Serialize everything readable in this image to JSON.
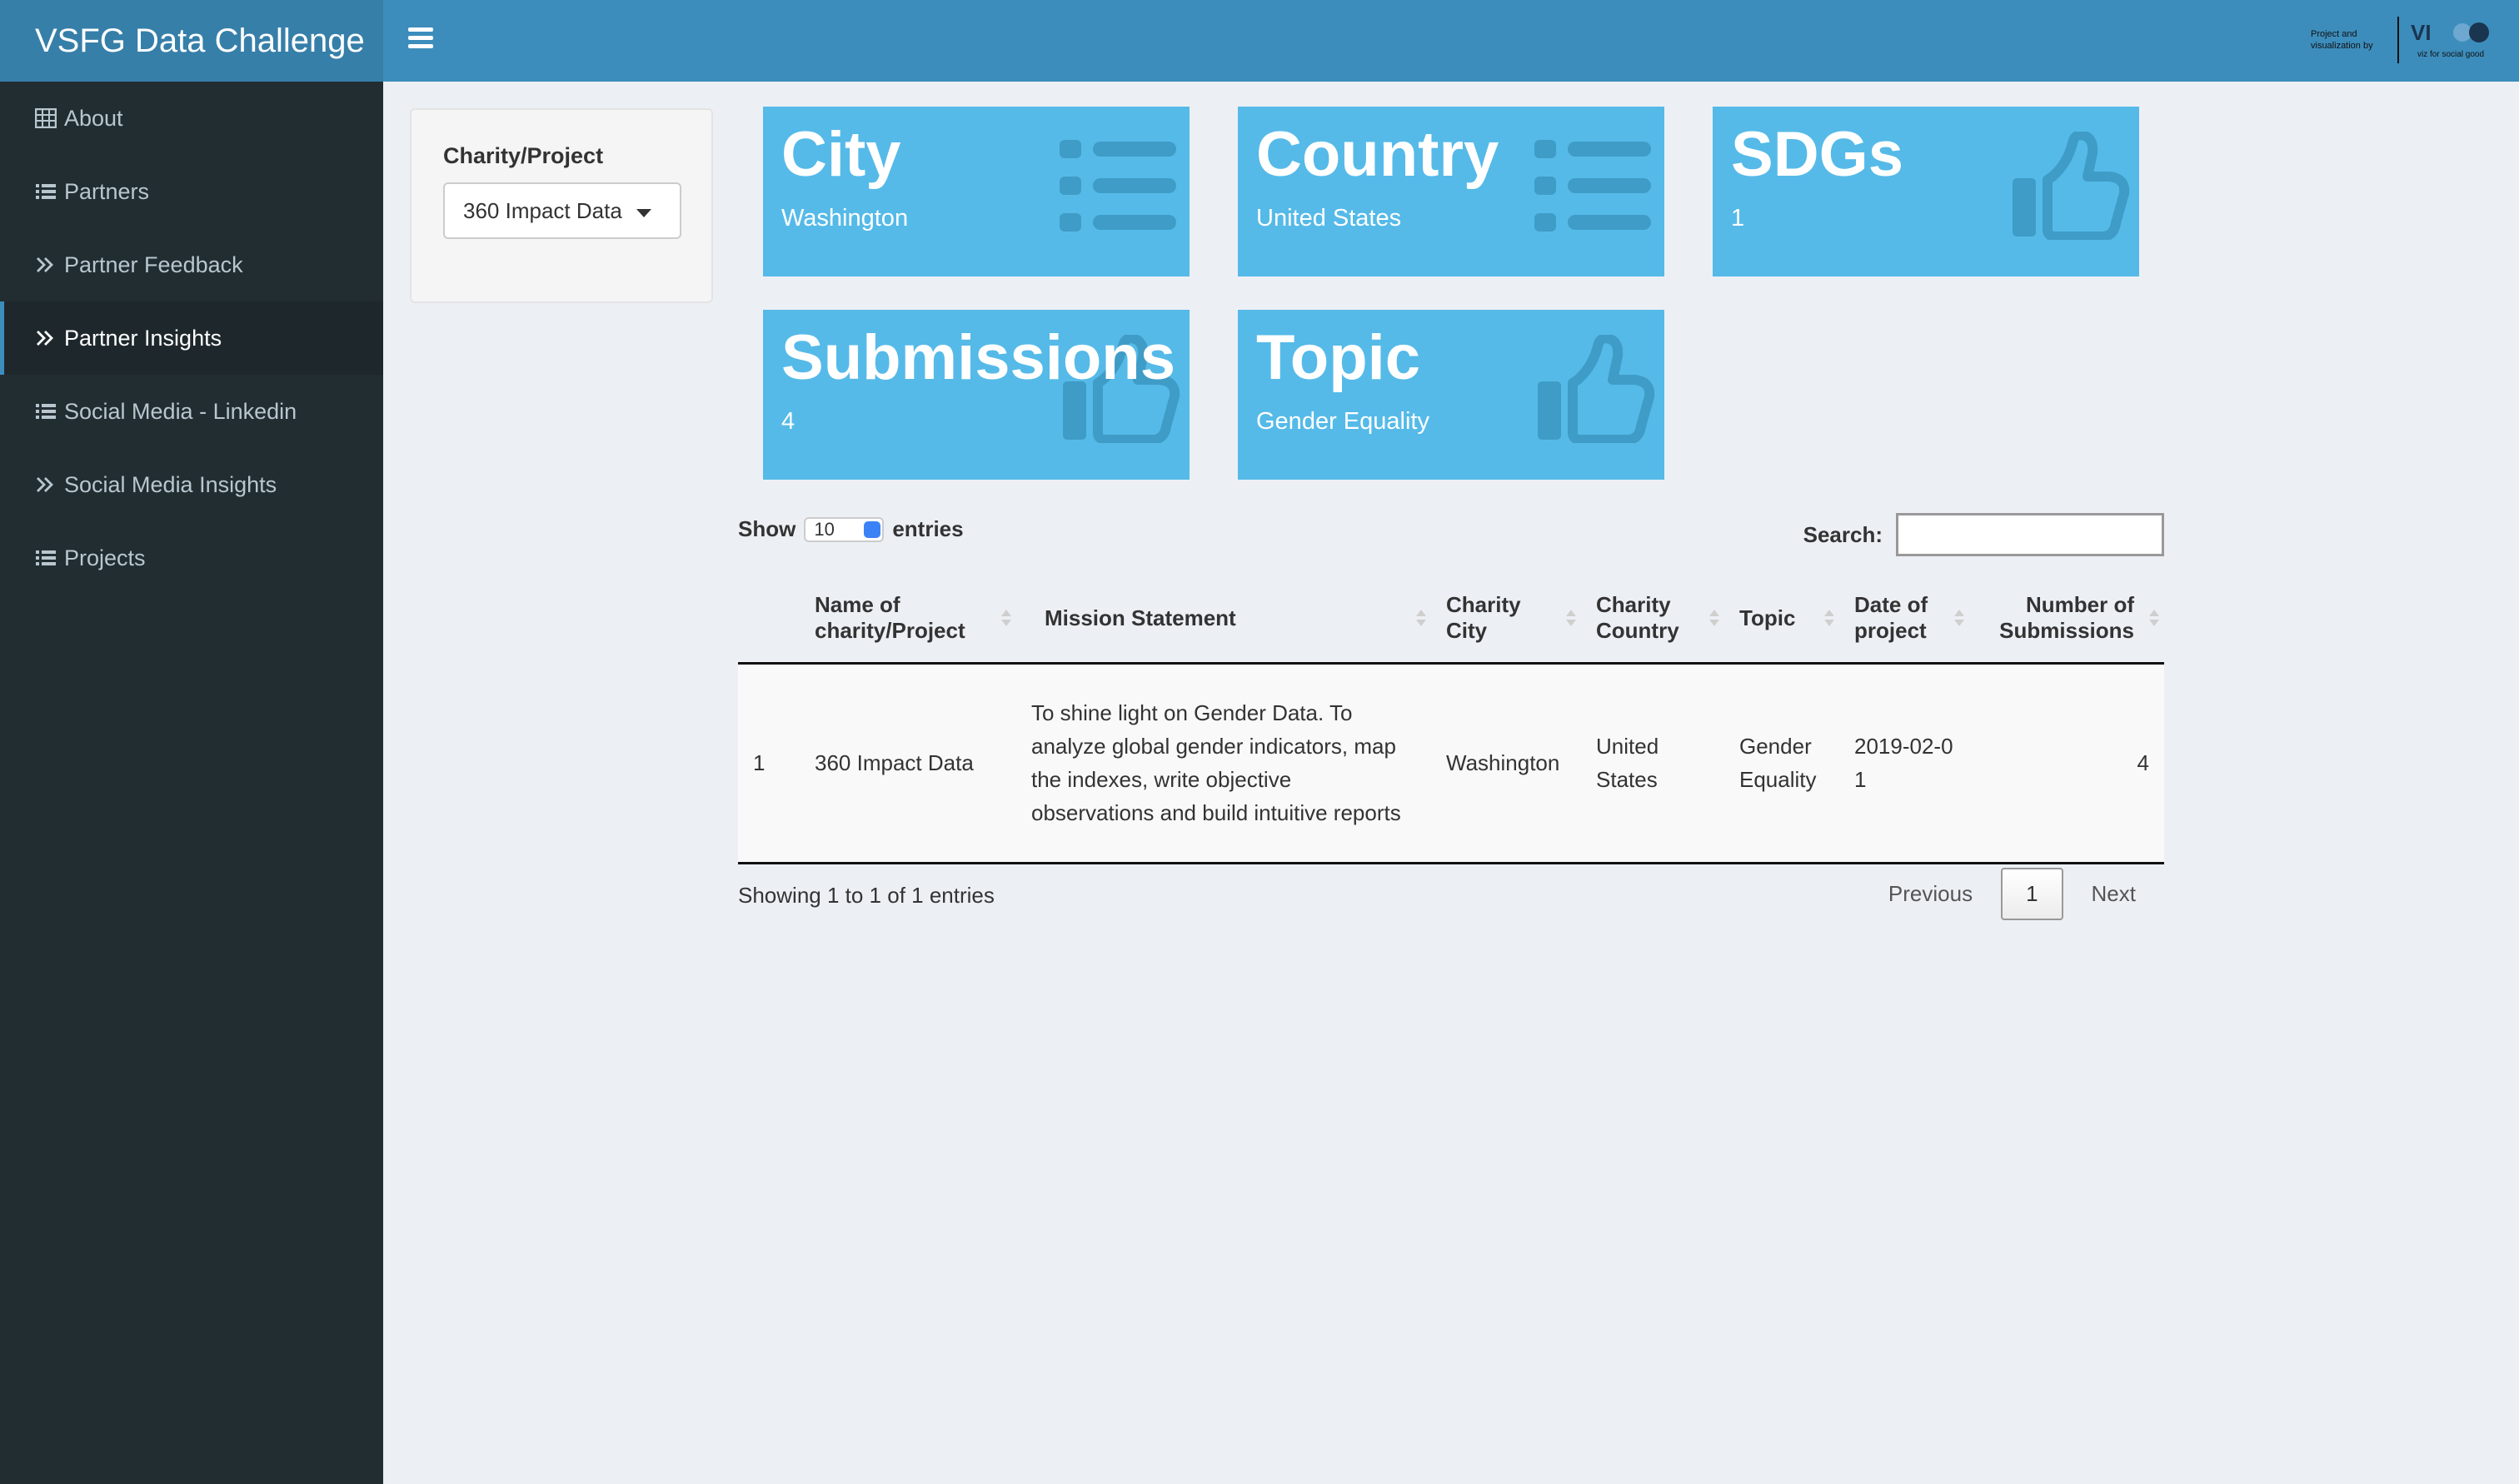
{
  "header": {
    "title": "VSFG Data Challenge",
    "brand_text": "Project and visualization by",
    "brand_sub": "viz for social good"
  },
  "sidebar": {
    "items": [
      {
        "label": "About",
        "icon": "table-icon"
      },
      {
        "label": "Partners",
        "icon": "list-icon"
      },
      {
        "label": "Partner Feedback",
        "icon": "angle-double-right-icon"
      },
      {
        "label": "Partner Insights",
        "icon": "angle-double-right-icon",
        "active": true
      },
      {
        "label": "Social Media - Linkedin",
        "icon": "list-icon"
      },
      {
        "label": "Social Media Insights",
        "icon": "angle-double-right-icon"
      },
      {
        "label": "Projects",
        "icon": "list-icon"
      }
    ]
  },
  "filter": {
    "label": "Charity/Project",
    "selected": "360 Impact Data"
  },
  "value_boxes": [
    {
      "title": "City",
      "value": "Washington",
      "icon": "list-icon"
    },
    {
      "title": "Country",
      "value": "United States",
      "icon": "list-icon"
    },
    {
      "title": "SDGs",
      "value": "1",
      "icon": "thumbs-up-icon"
    },
    {
      "title": "Submissions",
      "value": "4",
      "icon": "thumbs-up-icon"
    },
    {
      "title": "Topic",
      "value": "Gender Equality",
      "icon": "thumbs-up-icon"
    }
  ],
  "table": {
    "show_label": "Show",
    "entries_label": "entries",
    "length_value": "10",
    "search_label": "Search:",
    "search_value": "",
    "columns": [
      "",
      "Name of charity/Project",
      "Mission Statement",
      "Charity City",
      "Charity Country",
      "Topic",
      "Date of project",
      "Number of Submissions"
    ],
    "rows": [
      [
        "1",
        "360 Impact Data",
        "To shine light on Gender Data. To analyze global gender indicators, map the indexes, write objective observations and build intuitive reports",
        "Washington",
        "United States",
        "Gender Equality",
        "2019-02-01",
        "4"
      ]
    ],
    "info": "Showing 1 to 1 of 1 entries",
    "pager": {
      "previous": "Previous",
      "current": "1",
      "next": "Next"
    }
  },
  "colors": {
    "header": "#3c8dbc",
    "logo_bar": "#367fa9",
    "sidebar": "#222d32",
    "value_box": "#55bae8",
    "background": "#ecf0f5"
  }
}
